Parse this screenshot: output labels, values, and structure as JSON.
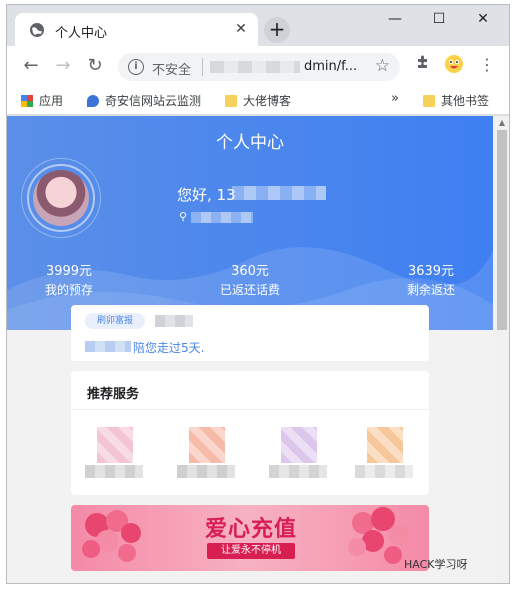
{
  "browser": {
    "tab_title": "个人中心",
    "tab_close": "✕",
    "new_tab": "+",
    "window_controls": {
      "minimize": "—",
      "maximize": "☐",
      "close": "✕"
    },
    "omnibox": {
      "security_label": "不安全",
      "url_visible": "dmin/f..."
    },
    "nav": {
      "back": "←",
      "forward": "→",
      "reload": "↻"
    },
    "bookmarks": [
      {
        "label": "应用",
        "icon": "apps-grid-icon"
      },
      {
        "label": "奇安信网站云监测",
        "icon": "shield-icon"
      },
      {
        "label": "大佬博客",
        "icon": "folder-icon"
      },
      {
        "label": "其他书签",
        "icon": "folder-icon"
      }
    ],
    "bookmarks_overflow": "»"
  },
  "page": {
    "title": "个人中心",
    "greeting": "您好, 13",
    "stats": [
      {
        "value": "3999元",
        "label": "我的预存"
      },
      {
        "value": "360元",
        "label": "已返还话费"
      },
      {
        "value": "3639元",
        "label": "剩余返还"
      }
    ],
    "membership": {
      "tag": "刷卯富报",
      "since_text": "陪您走过5天."
    },
    "recommend": {
      "title": "推荐服务",
      "services": [
        {
          "color": "#f3c4d2",
          "label_color": "#d0d0d0"
        },
        {
          "color": "#f7b9a8",
          "label_color": "#cfcfcf"
        },
        {
          "color": "#ddc6ec",
          "label_color": "#d3d3d3"
        },
        {
          "color": "#f6c79a",
          "label_color": "#dadada"
        }
      ]
    },
    "banner": {
      "headline": "爱心充值",
      "subline": "让爱永不停机"
    }
  },
  "watermark": "HACK学习呀",
  "colors": {
    "hero": "#4a86e8",
    "accent": "#4a86e8",
    "banner_text": "#d81f52"
  }
}
